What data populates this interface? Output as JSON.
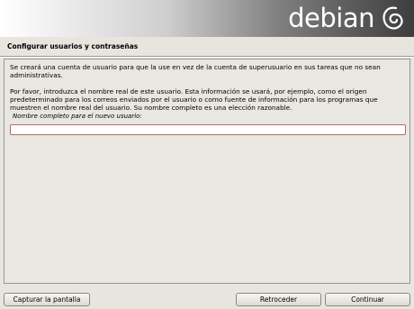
{
  "banner": {
    "logo_text": "debian",
    "logo_icon": "debian-swirl-icon"
  },
  "step": {
    "title": "Configurar usuarios y contraseñas"
  },
  "content": {
    "paragraph1": "Se creará una cuenta de usuario para que la use en vez de la cuenta de superusuario en sus tareas que no sean administrativas.",
    "paragraph2": "Por favor, introduzca el nombre real de este usuario. Esta información se usará, por ejemplo, como el origen predeterminado para los correos enviados por el usuario o como fuente de información para los programas que muestren el nombre real del usuario. Su nombre completo es una elección razonable.",
    "field_label": "Nombre completo para el nuevo usuario:",
    "field_value": ""
  },
  "buttons": {
    "capture": "Capturar la pantalla",
    "back": "Retroceder",
    "continue": "Continuar"
  },
  "colors": {
    "input_border": "#b86a60",
    "background": "#e7e5de"
  }
}
